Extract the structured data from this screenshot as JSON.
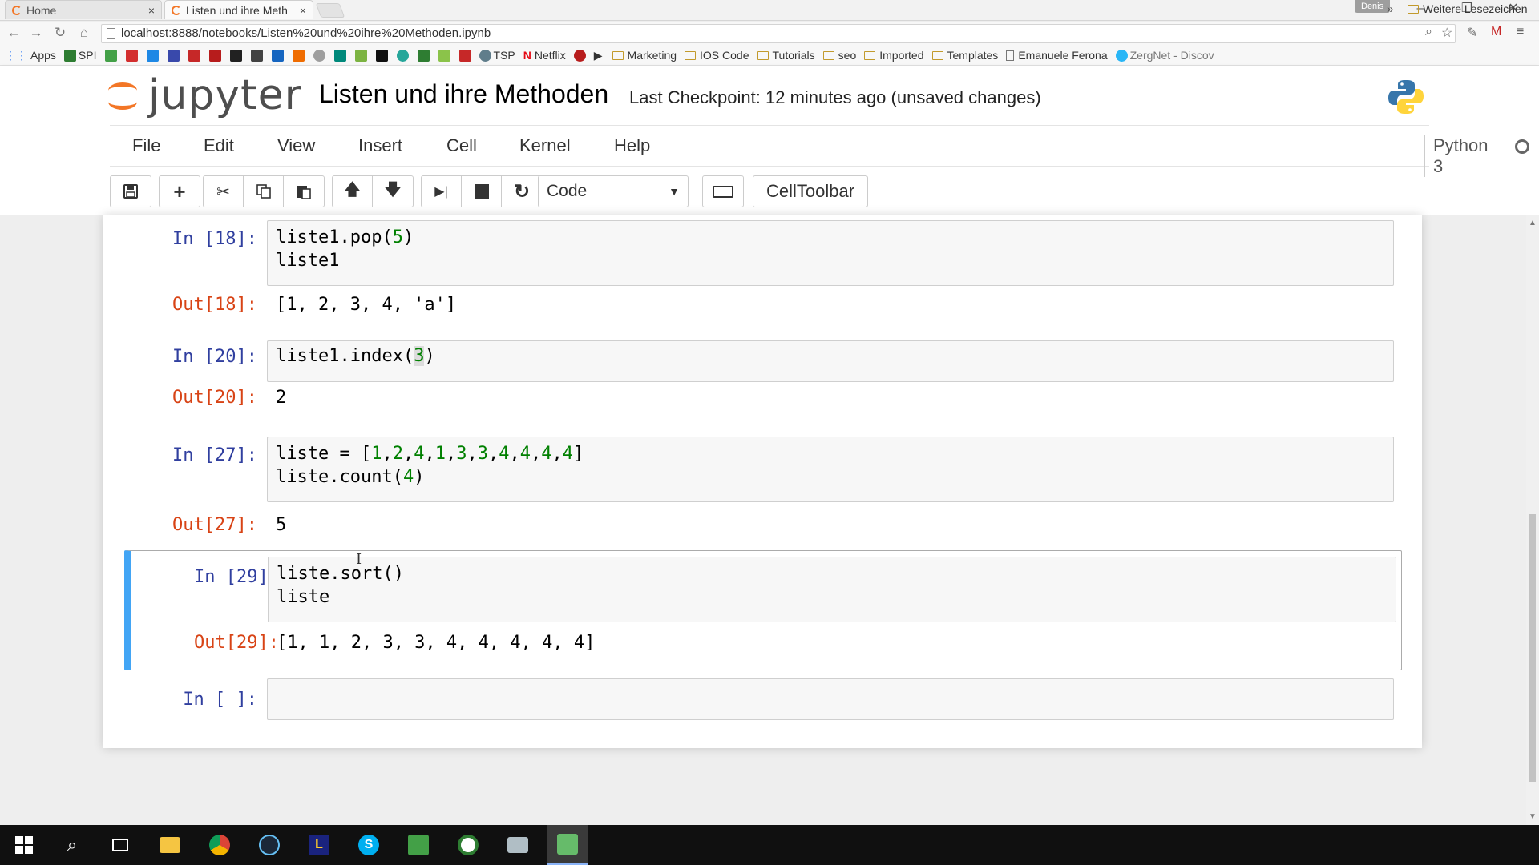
{
  "browser": {
    "tabs": [
      {
        "title": "Home",
        "active": false
      },
      {
        "title": "Listen und ihre Meth",
        "active": true
      }
    ],
    "profile": "Denis",
    "url": "localhost:8888/notebooks/Listen%20und%20ihre%20Methoden.ipynb",
    "bookmarks": [
      {
        "label": "Apps",
        "icon": "apps-grid-icon"
      },
      {
        "label": "SPI",
        "icon": "spi-icon"
      },
      {
        "label": "TSP",
        "icon": "tsp-icon"
      },
      {
        "label": "Netflix",
        "icon": "netflix-icon"
      },
      {
        "label": "Marketing",
        "icon": "folder-icon"
      },
      {
        "label": "IOS Code",
        "icon": "folder-icon"
      },
      {
        "label": "Tutorials",
        "icon": "folder-icon"
      },
      {
        "label": "seo",
        "icon": "folder-icon"
      },
      {
        "label": "Imported",
        "icon": "folder-icon"
      },
      {
        "label": "Templates",
        "icon": "folder-icon"
      },
      {
        "label": "Emanuele Ferona",
        "icon": "page-icon"
      },
      {
        "label": "ZergNet - Discov",
        "icon": "zergnet-icon"
      }
    ],
    "other_bookmarks": "Weitere Lesezeichen"
  },
  "jupyter": {
    "logo_text": "jupyter",
    "notebook_title": "Listen und ihre Methoden",
    "checkpoint": "Last Checkpoint: 12 minutes ago (unsaved changes)",
    "menu": [
      "File",
      "Edit",
      "View",
      "Insert",
      "Cell",
      "Kernel",
      "Help"
    ],
    "kernel": "Python 3",
    "cell_type": "Code",
    "celltoolbar_label": "CellToolbar"
  },
  "cells": [
    {
      "in_prompt": "In [18]:",
      "code": [
        "liste1.pop(5)",
        "liste1"
      ],
      "out_prompt": "Out[18]:",
      "output": "[1, 2, 3, 4, 'a']"
    },
    {
      "in_prompt": "In [20]:",
      "code": [
        "liste1.index(3)"
      ],
      "out_prompt": "Out[20]:",
      "output": "2"
    },
    {
      "in_prompt": "In [27]:",
      "code": [
        "liste = [1,2,4,1,3,3,4,4,4,4]",
        "liste.count(4)"
      ],
      "out_prompt": "Out[27]:",
      "output": "5"
    },
    {
      "in_prompt": "In [29]:",
      "code": [
        "liste.sort()",
        "liste"
      ],
      "out_prompt": "Out[29]:",
      "output": "[1, 1, 2, 3, 3, 4, 4, 4, 4, 4]",
      "selected": true
    },
    {
      "in_prompt": "In [ ]:",
      "code": [
        ""
      ]
    }
  ],
  "colors": {
    "jupyter_orange": "#f37626",
    "in_prompt": "#303f9f",
    "out_prompt": "#d84315",
    "selected_cell_bar": "#42a5f5",
    "number_literal": "#008000"
  }
}
